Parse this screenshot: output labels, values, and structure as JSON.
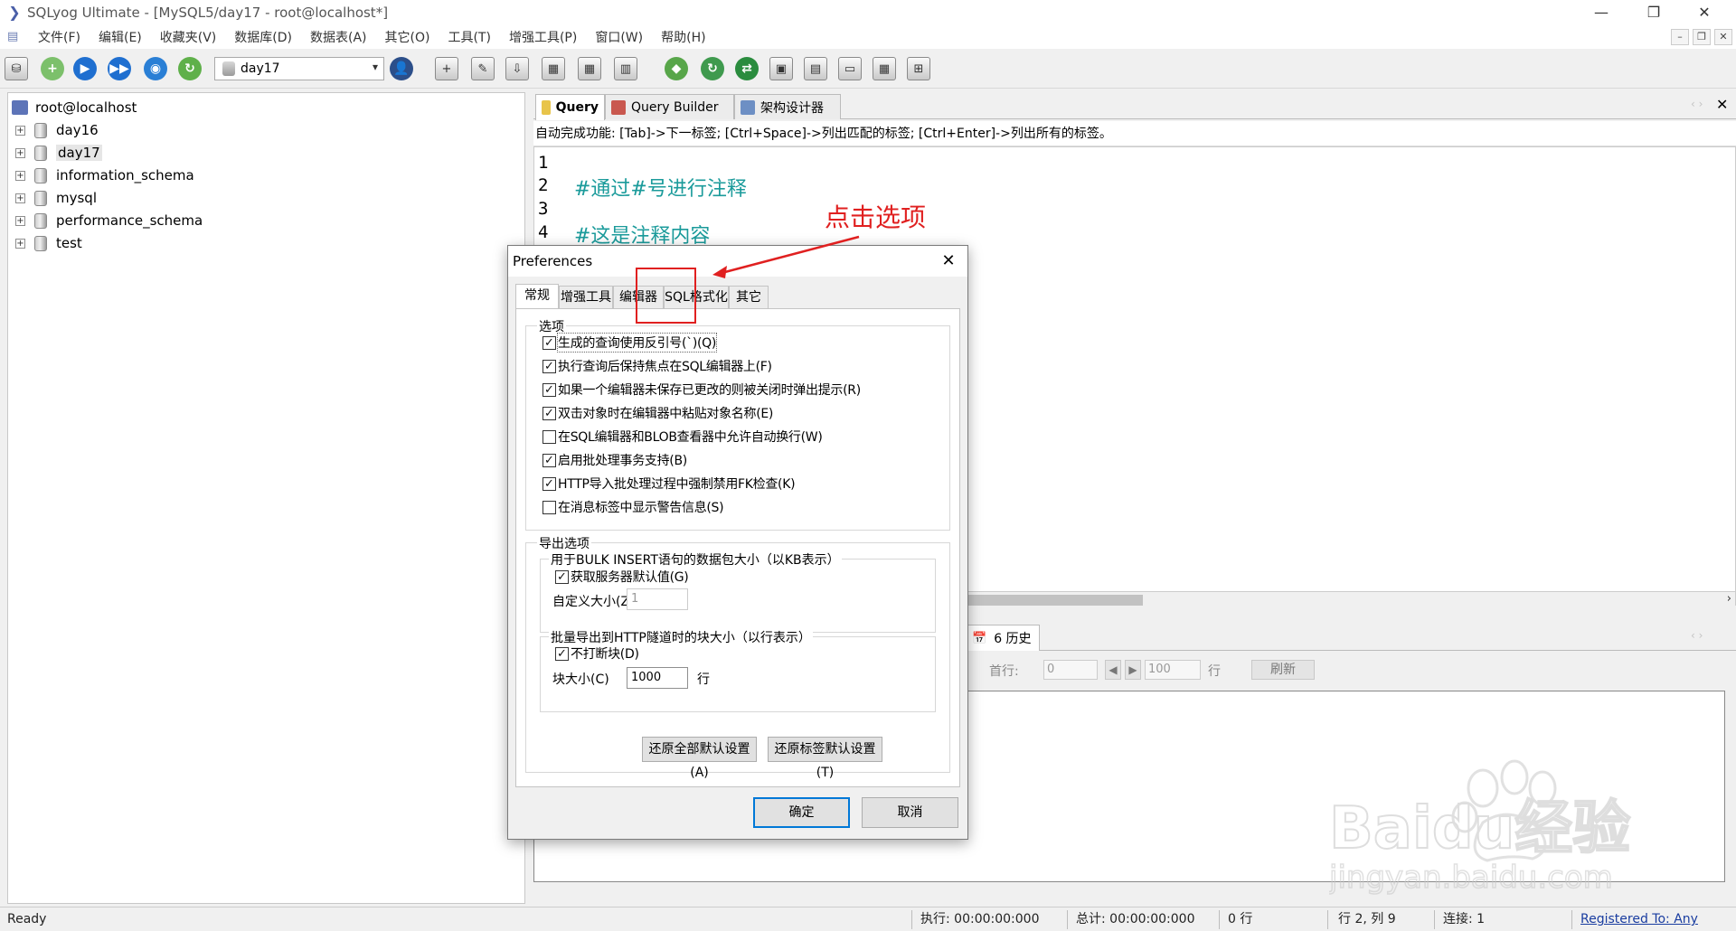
{
  "window": {
    "title": "SQLyog Ultimate - [MySQL5/day17 - root@localhost*]",
    "minimize": "—",
    "restore": "❐",
    "close": "✕"
  },
  "menu": {
    "items": [
      "文件(F)",
      "编辑(E)",
      "收藏夹(V)",
      "数据库(D)",
      "数据表(A)",
      "其它(O)",
      "工具(T)",
      "增强工具(P)",
      "窗口(W)",
      "帮助(H)"
    ],
    "mdi_min": "–",
    "mdi_restore": "❐",
    "mdi_close": "✕"
  },
  "toolbar": {
    "database_selected": "day17"
  },
  "object_browser": {
    "root": "root@localhost",
    "databases": [
      "day16",
      "day17",
      "information_schema",
      "mysql",
      "performance_schema",
      "test"
    ]
  },
  "query_tabs": {
    "tabs": [
      "Query",
      "Query Builder",
      "架构设计器"
    ],
    "close": "✕"
  },
  "autocomplete_hint": "自动完成功能: [Tab]->下一标签; [Ctrl+Space]->列出匹配的标签; [Ctrl+Enter]->列出所有的标签。",
  "editor": {
    "line_numbers": [
      "1",
      "2",
      "3",
      "4"
    ],
    "lines": [
      "",
      "#通过#号进行注释",
      "",
      "#这是注释内容"
    ]
  },
  "result": {
    "tab_label": "6 历史",
    "first_row_label": "首行:",
    "first_row_value": "0",
    "rows_value": "100",
    "rows_label": "行",
    "refresh": "刷新"
  },
  "statusbar": {
    "ready": "Ready",
    "exec": "执行: 00:00:00:000",
    "total": "总计: 00:00:00:000",
    "rows": "0 行",
    "position": "行 2, 列 9",
    "connections": "连接: 1",
    "registered": "Registered To: Any"
  },
  "dialog": {
    "title": "Preferences",
    "tabs": [
      "常规",
      "增强工具",
      "编辑器",
      "SQL格式化",
      "其它"
    ],
    "options_group": "选项",
    "options": [
      {
        "label": "生成的查询使用反引号(`)(Q)",
        "checked": true
      },
      {
        "label": "执行查询后保持焦点在SQL编辑器上(F)",
        "checked": true
      },
      {
        "label": "如果一个编辑器未保存已更改的则被关闭时弹出提示(R)",
        "checked": true
      },
      {
        "label": "双击对象时在编辑器中粘贴对象名称(E)",
        "checked": true
      },
      {
        "label": "在SQL编辑器和BLOB查看器中允许自动换行(W)",
        "checked": false
      },
      {
        "label": "启用批处理事务支持(B)",
        "checked": true
      },
      {
        "label": "HTTP导入批处理过程中强制禁用FK检查(K)",
        "checked": true
      },
      {
        "label": "在消息标签中显示警告信息(S)",
        "checked": false
      }
    ],
    "export_group": "导出选项",
    "bulk_group": "用于BULK INSERT语句的数据包大小（以KB表示）",
    "bulk_default": "获取服务器默认值(G)",
    "bulk_custom_label": "自定义大小(Z)",
    "bulk_custom_value": "1",
    "chunk_group": "批量导出到HTTP隧道时的块大小（以行表示）",
    "chunk_nobreak": "不打断块(D)",
    "chunk_size_label": "块大小(C)",
    "chunk_size_value": "1000",
    "chunk_unit": "行",
    "restore_all": "还原全部默认设置(A)",
    "restore_tab": "还原标签默认设置(T)",
    "ok": "确定",
    "cancel": "取消",
    "close": "✕"
  },
  "annotation": {
    "text": "点击选项",
    "color": "#e02020"
  },
  "watermark": {
    "text": "Baidu经验",
    "url": "jingyan.baidu.com"
  }
}
